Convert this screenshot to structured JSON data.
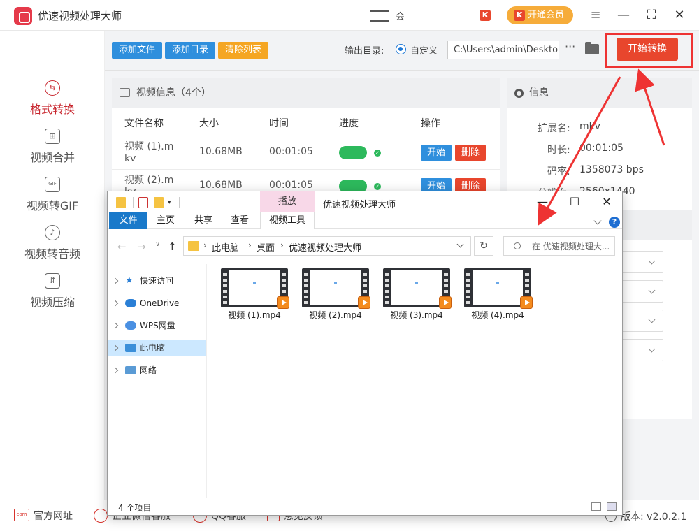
{
  "app": {
    "title": "优速视频处理大师",
    "user_label": "会",
    "user_name": "",
    "k_badge": "K",
    "vip_label": "开通会员",
    "window_controls": [
      "menu-icon",
      "minimize-icon",
      "maximize-icon",
      "close-icon"
    ]
  },
  "sidebar": {
    "items": [
      {
        "label": "格式转换",
        "icon": "convert-icon",
        "active": true
      },
      {
        "label": "视频合并",
        "icon": "merge-icon",
        "active": false
      },
      {
        "label": "视频转GIF",
        "icon": "gif-icon",
        "active": false
      },
      {
        "label": "视频转音频",
        "icon": "audio-icon",
        "active": false
      },
      {
        "label": "视频压缩",
        "icon": "compress-icon",
        "active": false
      }
    ]
  },
  "toolbar": {
    "add_file": "添加文件",
    "add_dir": "添加目录",
    "clear_list": "清除列表",
    "output_label": "输出目录:",
    "output_option": "自定义",
    "output_path": "C:\\Users\\admin\\Desktop",
    "more": "···",
    "start": "开始转换"
  },
  "video_panel": {
    "title": "视频信息（4个）",
    "columns": [
      "文件名称",
      "大小",
      "时间",
      "进度",
      "操作"
    ],
    "rows": [
      {
        "name_l1": "视频 (1).m",
        "name_l2": "kv",
        "size": "10.68MB",
        "time": "00:01:05",
        "start": "开始",
        "delete": "删除"
      },
      {
        "name_l1": "视频 (2).m",
        "name_l2": "kv",
        "size": "10.68MB",
        "time": "00:01:05",
        "start": "开始",
        "delete": "删除"
      }
    ]
  },
  "info_panel": {
    "title": "信息",
    "fields": [
      {
        "label": "扩展名:",
        "value": "mkv"
      },
      {
        "label": "时长:",
        "value": "00:01:05"
      },
      {
        "label": "码率:",
        "value": "1358073 bps"
      },
      {
        "label": "分辨率:",
        "value": "2560x1440"
      }
    ]
  },
  "bottom": {
    "links": [
      "官方网址",
      "企业微信客服",
      "QQ客服",
      "意见反馈"
    ],
    "version": "版本: v2.0.2.1"
  },
  "explorer": {
    "play_tab": "播放",
    "window_title": "优速视频处理大师",
    "ribbon_tabs": [
      "文件",
      "主页",
      "共享",
      "查看",
      "视频工具"
    ],
    "breadcrumb": [
      "此电脑",
      "桌面",
      "优速视频处理大师"
    ],
    "search_placeholder": "在 优速视频处理大...",
    "nav_items": [
      {
        "label": "快速访问",
        "icon": "star-icon"
      },
      {
        "label": "OneDrive",
        "icon": "cloud-icon"
      },
      {
        "label": "WPS网盘",
        "icon": "wps-cloud-icon"
      },
      {
        "label": "此电脑",
        "icon": "computer-icon",
        "selected": true
      },
      {
        "label": "网络",
        "icon": "network-icon"
      }
    ],
    "files": [
      "视频 (1).mp4",
      "视频 (2).mp4",
      "视频 (3).mp4",
      "视频 (4).mp4"
    ],
    "status": "4 个项目"
  },
  "annotation": {
    "color": "#e33"
  }
}
